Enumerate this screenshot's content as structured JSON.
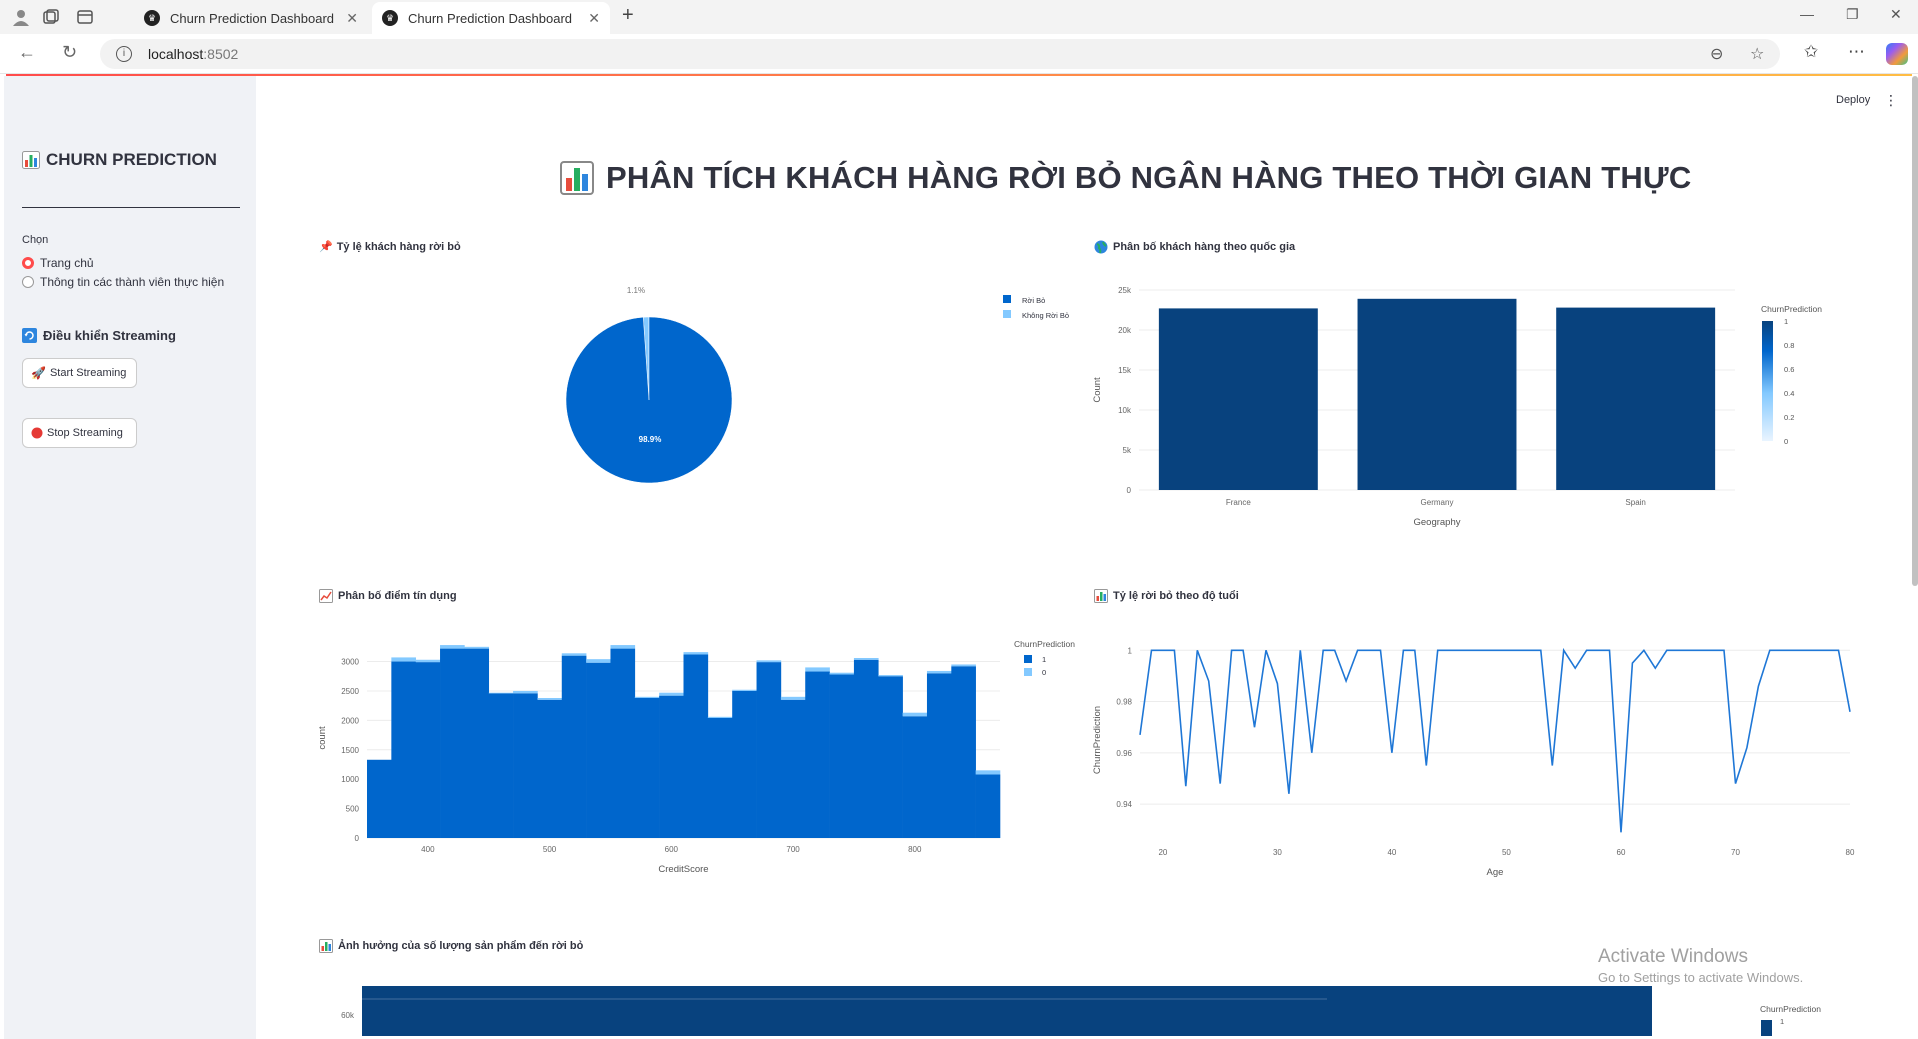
{
  "browser": {
    "tabs": [
      {
        "title": "Churn Prediction Dashboard",
        "active": false
      },
      {
        "title": "Churn Prediction Dashboard",
        "active": true
      }
    ],
    "url_host": "localhost",
    "url_port": ":8502"
  },
  "app": {
    "deploy_label": "Deploy",
    "title": "PHÂN TÍCH KHÁCH HÀNG RỜI BỎ NGÂN HÀNG THEO THỜI GIAN THỰC"
  },
  "sidebar": {
    "title": "CHURN PREDICTION",
    "select_label": "Chọn",
    "options": [
      "Trang chủ",
      "Thông tin các thành viên thực hiện"
    ],
    "selected": 0,
    "streaming_header": "Điều khiển Streaming",
    "start_button": "Start Streaming",
    "stop_button": "Stop Streaming"
  },
  "sections": {
    "pie": "Tỷ lệ khách hàng rời bỏ",
    "geo": "Phân bố khách hàng theo quốc gia",
    "credit": "Phân bố điểm tín dụng",
    "age": "Tỷ lệ rời bỏ theo độ tuổi",
    "products": "Ảnh hưởng của số lượng sản phẩm đến rời bỏ"
  },
  "chart_data": [
    {
      "type": "pie",
      "labels": [
        "Rời Bỏ",
        "Không Rời Bỏ"
      ],
      "values": [
        98.9,
        1.1
      ],
      "text": [
        "98.9%",
        "1.1%"
      ],
      "colors": [
        "#0066cc",
        "#83c9ff"
      ],
      "legend": "right"
    },
    {
      "type": "bar",
      "categories": [
        "France",
        "Germany",
        "Spain"
      ],
      "values": [
        22700,
        23900,
        22800
      ],
      "xlabel": "Geography",
      "ylabel": "Count",
      "ylim": [
        0,
        25000
      ],
      "yticks": [
        "0",
        "5k",
        "10k",
        "15k",
        "20k",
        "25k"
      ],
      "colorbar": {
        "title": "ChurnPrediction",
        "ticks": [
          "0",
          "0.2",
          "0.4",
          "0.6",
          "0.8",
          "1"
        ]
      },
      "color": "#08427e"
    },
    {
      "type": "bar",
      "subtype": "histogram",
      "x_start": 350,
      "bin_width": 20,
      "series": [
        {
          "name": "1",
          "values": [
            1330,
            3000,
            2990,
            3220,
            3220,
            2460,
            2460,
            2350,
            3100,
            2980,
            3220,
            2380,
            2420,
            3120,
            2040,
            2500,
            2990,
            2350,
            2830,
            2780,
            3030,
            2750,
            2070,
            2800,
            2920,
            1080
          ]
        },
        {
          "name": "0",
          "values": [
            0,
            70,
            40,
            60,
            30,
            10,
            40,
            30,
            40,
            60,
            60,
            20,
            50,
            40,
            20,
            20,
            30,
            50,
            70,
            30,
            30,
            20,
            60,
            40,
            30,
            70
          ]
        }
      ],
      "colors": [
        "#0066cc",
        "#83c9ff"
      ],
      "xlabel": "CreditScore",
      "ylabel": "count",
      "xticks": [
        400,
        500,
        600,
        700,
        800
      ],
      "yticks": [
        0,
        500,
        1000,
        1500,
        2000,
        2500,
        3000
      ],
      "ylim": [
        0,
        3400
      ],
      "legend_title": "ChurnPrediction"
    },
    {
      "type": "line",
      "x": [
        18,
        19,
        20,
        21,
        22,
        23,
        24,
        25,
        26,
        27,
        28,
        29,
        30,
        31,
        32,
        33,
        34,
        35,
        36,
        37,
        38,
        39,
        40,
        41,
        42,
        43,
        44,
        45,
        46,
        47,
        48,
        49,
        50,
        51,
        52,
        53,
        54,
        55,
        56,
        57,
        58,
        59,
        60,
        61,
        62,
        63,
        64,
        65,
        66,
        67,
        68,
        69,
        70,
        71,
        72,
        73,
        74,
        75,
        76,
        77,
        78,
        79,
        80
      ],
      "y": [
        0.967,
        1,
        1,
        1,
        0.947,
        1,
        0.988,
        0.948,
        1,
        1,
        0.97,
        1,
        0.987,
        0.944,
        1,
        0.96,
        1,
        1,
        0.988,
        1,
        1,
        1,
        0.96,
        1,
        1,
        0.955,
        1,
        1,
        1,
        1,
        1,
        1,
        1,
        1,
        1,
        1,
        0.955,
        1,
        0.993,
        1,
        1,
        1,
        0.929,
        0.995,
        1,
        0.993,
        1,
        1,
        1,
        1,
        1,
        1,
        0.948,
        0.962,
        0.986,
        1,
        1,
        1,
        1,
        1,
        1,
        1,
        0.976
      ],
      "xlabel": "Age",
      "ylabel": "ChurnPrediction",
      "xticks": [
        20,
        30,
        40,
        50,
        60,
        70,
        80
      ],
      "yticks": [
        0.94,
        0.96,
        0.98,
        1
      ],
      "xlim": [
        18,
        80
      ],
      "ylim": [
        0.926,
        1.004
      ],
      "color": "#1f77d6"
    },
    {
      "type": "bar",
      "partial": true,
      "ylabel_ticks": [
        "60k"
      ],
      "colorbar": {
        "title": "ChurnPrediction",
        "ticks": [
          "1"
        ]
      },
      "color": "#08427e"
    }
  ],
  "watermark": {
    "line1": "Activate Windows",
    "line2": "Go to Settings to activate Windows."
  }
}
